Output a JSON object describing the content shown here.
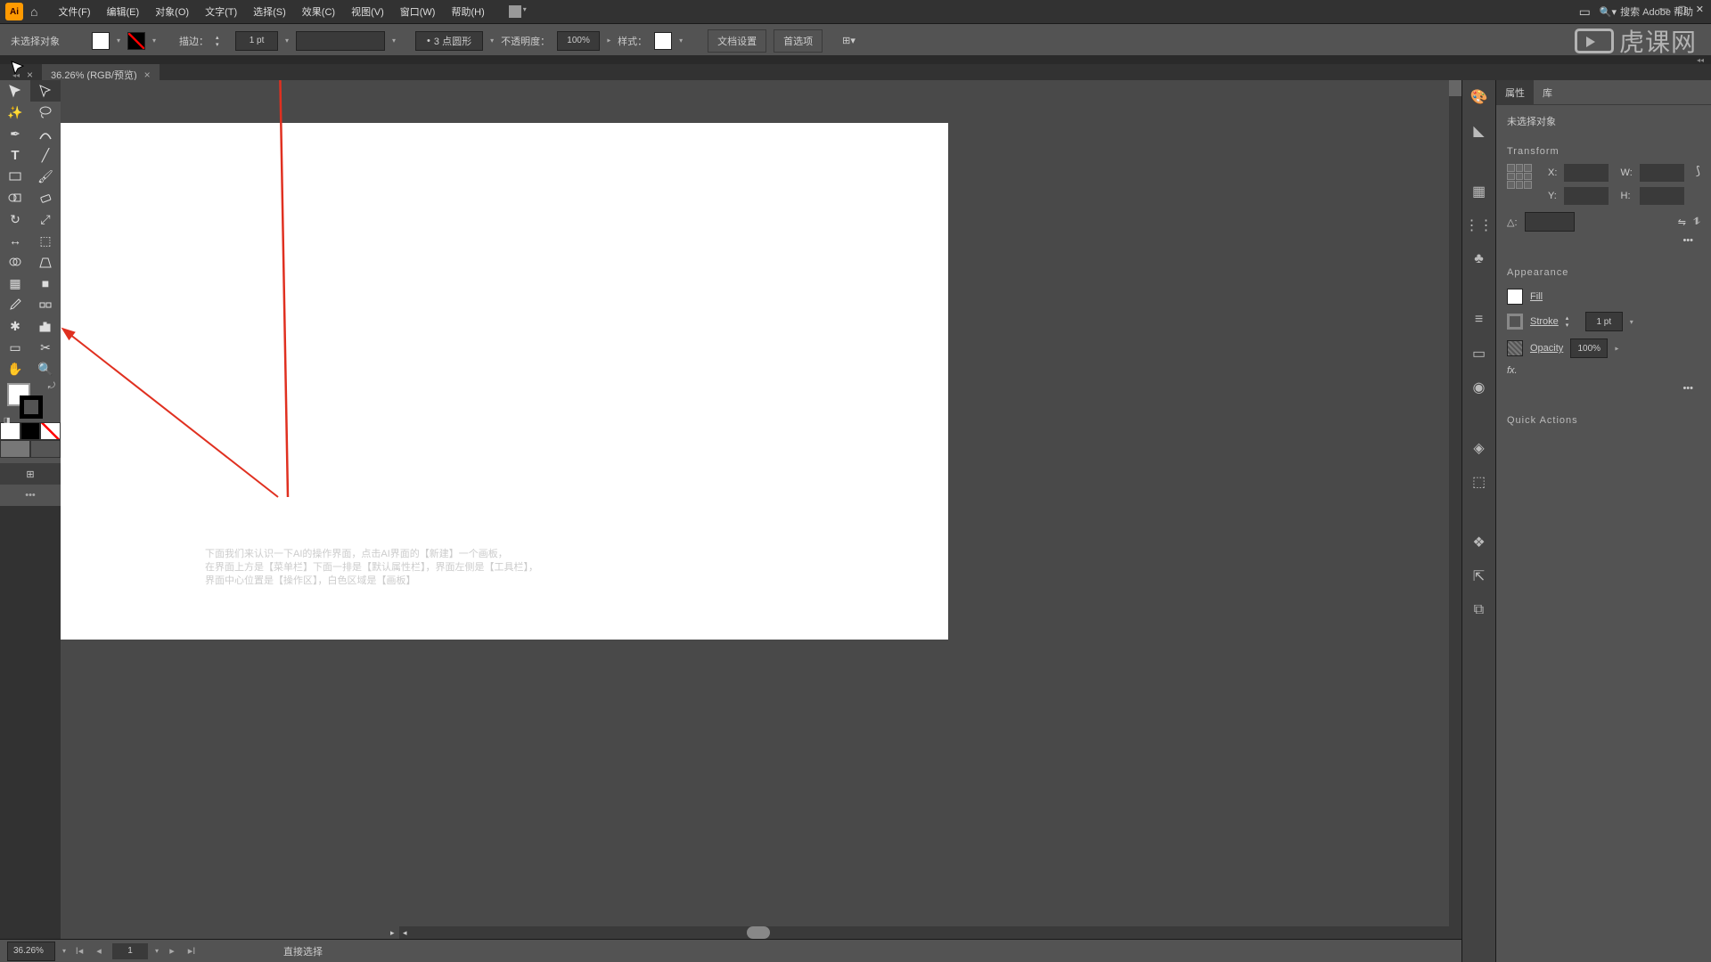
{
  "menubar": {
    "items": [
      {
        "label": "文件(F)"
      },
      {
        "label": "编辑(E)"
      },
      {
        "label": "对象(O)"
      },
      {
        "label": "文字(T)"
      },
      {
        "label": "选择(S)"
      },
      {
        "label": "效果(C)"
      },
      {
        "label": "视图(V)"
      },
      {
        "label": "窗口(W)"
      },
      {
        "label": "帮助(H)"
      }
    ],
    "search_placeholder": "搜索 Adobe 帮助"
  },
  "controlbar": {
    "no_selection": "未选择对象",
    "stroke_label": "描边：",
    "stroke_value": "1 pt",
    "dash_value": "3 点圆形",
    "opacity_label": "不透明度：",
    "opacity_value": "100%",
    "style_label": "样式：",
    "doc_setup": "文档设置",
    "preferences": "首选项"
  },
  "document": {
    "tab_label": "36.26% (RGB/预览)"
  },
  "annotations": {
    "line1": "下面我们来认识一下AI的操作界面，点击AI界面的【新建】一个画板，",
    "line2": "在界面上方是【菜单栏】下面一排是【默认属性栏】，界面左侧是【工具栏】，",
    "line3": "界面中心位置是【操作区】，白色区域是【画板】"
  },
  "properties": {
    "tabs": {
      "props": "属性",
      "libs": "库"
    },
    "no_selection": "未选择对象",
    "transform": {
      "title": "Transform",
      "x_label": "X:",
      "y_label": "Y:",
      "w_label": "W:",
      "h_label": "H:",
      "x": "",
      "y": "",
      "w": "",
      "h": "",
      "angle": "△:"
    },
    "appearance": {
      "title": "Appearance",
      "fill": "Fill",
      "stroke": "Stroke",
      "stroke_val": "1 pt",
      "opacity": "Opacity",
      "opacity_val": "100%",
      "fx": "fx."
    },
    "quick_actions": "Quick Actions"
  },
  "status": {
    "zoom": "36.26%",
    "page": "1",
    "tool": "直接选择"
  },
  "watermark": "虎课网"
}
